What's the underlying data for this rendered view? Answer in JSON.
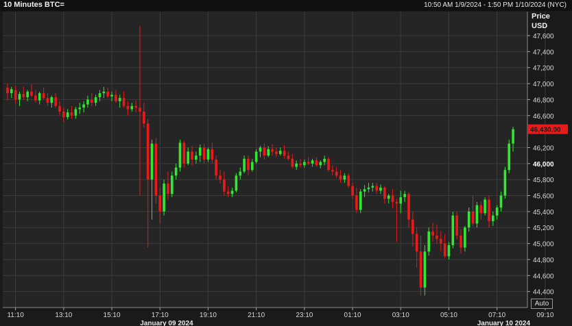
{
  "header": {
    "title": "10 Minutes BTC=",
    "range": "10:50 AM 1/9/2024 - 1:50 PM 1/10/2024 (NYC)"
  },
  "axis_header": {
    "line1": "Price",
    "line2": "USD"
  },
  "auto_button": "Auto",
  "colors": {
    "up": "#33e633",
    "down": "#e81a1a",
    "grid": "#3c3c3c",
    "background": "#252525"
  },
  "chart_data": {
    "type": "candlestick",
    "ylim": [
      44200,
      47900
    ],
    "grid": true,
    "y_ticks": [
      {
        "v": 47600,
        "label": "47,600"
      },
      {
        "v": 47400,
        "label": "47,400"
      },
      {
        "v": 47200,
        "label": "47,200"
      },
      {
        "v": 47000,
        "label": "47,000"
      },
      {
        "v": 46800,
        "label": "46,800"
      },
      {
        "v": 46600,
        "label": "46,600"
      },
      {
        "v": 46200,
        "label": "46,200"
      },
      {
        "v": 46000,
        "label": "46,000",
        "bold": true
      },
      {
        "v": 45800,
        "label": "45,800"
      },
      {
        "v": 45600,
        "label": "45,600"
      },
      {
        "v": 45400,
        "label": "45,400"
      },
      {
        "v": 45200,
        "label": "45,200"
      },
      {
        "v": 45000,
        "label": "45,000"
      },
      {
        "v": 44800,
        "label": "44,800"
      },
      {
        "v": 44600,
        "label": "44,600"
      },
      {
        "v": 44400,
        "label": "44,400"
      }
    ],
    "x_ticks": [
      {
        "i": 2,
        "label": "11:10"
      },
      {
        "i": 14,
        "label": "13:10"
      },
      {
        "i": 26,
        "label": "15:10"
      },
      {
        "i": 38,
        "label": "17:10"
      },
      {
        "i": 50,
        "label": "19:10"
      },
      {
        "i": 62,
        "label": "21:10"
      },
      {
        "i": 74,
        "label": "23:10"
      },
      {
        "i": 86,
        "label": "01:10"
      },
      {
        "i": 98,
        "label": "03:10"
      },
      {
        "i": 110,
        "label": "05:10"
      },
      {
        "i": 122,
        "label": "07:10"
      },
      {
        "i": 134,
        "label": "09:10"
      },
      {
        "i": 146,
        "label": "11:10"
      },
      {
        "i": 158,
        "label": "13:10"
      }
    ],
    "date_labels": [
      {
        "i": 40,
        "label": "January 09 2024"
      },
      {
        "i": 124,
        "label": "January 10 2024"
      }
    ],
    "last_price": {
      "value": 46430,
      "label": "46,430.00"
    },
    "candles": [
      [
        46950,
        47000,
        46800,
        46880
      ],
      [
        46880,
        46960,
        46820,
        46930
      ],
      [
        46920,
        46970,
        46750,
        46800
      ],
      [
        46800,
        46900,
        46720,
        46870
      ],
      [
        46870,
        46960,
        46800,
        46830
      ],
      [
        46830,
        46920,
        46780,
        46900
      ],
      [
        46900,
        46990,
        46830,
        46850
      ],
      [
        46850,
        46920,
        46760,
        46790
      ],
      [
        46790,
        46900,
        46740,
        46880
      ],
      [
        46880,
        46950,
        46800,
        46820
      ],
      [
        46820,
        46880,
        46720,
        46760
      ],
      [
        46760,
        46850,
        46700,
        46830
      ],
      [
        46830,
        46880,
        46700,
        46720
      ],
      [
        46720,
        46780,
        46600,
        46650
      ],
      [
        46650,
        46700,
        46520,
        46580
      ],
      [
        46580,
        46680,
        46550,
        46640
      ],
      [
        46640,
        46720,
        46560,
        46600
      ],
      [
        46600,
        46710,
        46560,
        46680
      ],
      [
        46680,
        46760,
        46620,
        46700
      ],
      [
        46700,
        46780,
        46640,
        46740
      ],
      [
        46740,
        46850,
        46700,
        46800
      ],
      [
        46800,
        46880,
        46720,
        46760
      ],
      [
        46760,
        46860,
        46720,
        46830
      ],
      [
        46830,
        46920,
        46780,
        46880
      ],
      [
        46880,
        46960,
        46820,
        46900
      ],
      [
        46900,
        46950,
        46820,
        46840
      ],
      [
        46840,
        46900,
        46780,
        46860
      ],
      [
        46860,
        46920,
        46760,
        46780
      ],
      [
        46780,
        46860,
        46700,
        46820
      ],
      [
        46820,
        46900,
        46700,
        46720
      ],
      [
        46720,
        46780,
        46600,
        46680
      ],
      [
        46680,
        46760,
        46650,
        46720
      ],
      [
        46720,
        46790,
        46640,
        46700
      ],
      [
        46700,
        47720,
        45600,
        46650
      ],
      [
        46650,
        46760,
        46450,
        46500
      ],
      [
        46500,
        46560,
        44950,
        45800
      ],
      [
        45800,
        46300,
        45300,
        46250
      ],
      [
        46250,
        46320,
        45500,
        45600
      ],
      [
        45600,
        45700,
        45250,
        45400
      ],
      [
        45400,
        45800,
        45350,
        45750
      ],
      [
        45750,
        45900,
        45550,
        45620
      ],
      [
        45620,
        45900,
        45580,
        45850
      ],
      [
        45850,
        46000,
        45800,
        45950
      ],
      [
        45950,
        46300,
        45900,
        46260
      ],
      [
        46260,
        46280,
        45950,
        46000
      ],
      [
        46000,
        46200,
        45980,
        46150
      ],
      [
        46150,
        46220,
        45980,
        46050
      ],
      [
        46050,
        46150,
        46000,
        46100
      ],
      [
        46100,
        46240,
        46020,
        46200
      ],
      [
        46200,
        46250,
        46000,
        46050
      ],
      [
        46050,
        46200,
        46020,
        46180
      ],
      [
        46180,
        46260,
        46000,
        46050
      ],
      [
        46050,
        46100,
        45800,
        45850
      ],
      [
        45850,
        45920,
        45750,
        45800
      ],
      [
        45800,
        45900,
        45600,
        45650
      ],
      [
        45650,
        45720,
        45580,
        45620
      ],
      [
        45620,
        45700,
        45580,
        45660
      ],
      [
        45660,
        45880,
        45640,
        45850
      ],
      [
        45850,
        45950,
        45800,
        45900
      ],
      [
        45900,
        46100,
        45880,
        46060
      ],
      [
        46060,
        46100,
        45850,
        45920
      ],
      [
        45920,
        46060,
        45900,
        46020
      ],
      [
        46020,
        46180,
        46000,
        46150
      ],
      [
        46150,
        46220,
        46080,
        46200
      ],
      [
        46200,
        46250,
        46050,
        46100
      ],
      [
        46100,
        46220,
        46080,
        46180
      ],
      [
        46180,
        46240,
        46100,
        46150
      ],
      [
        46150,
        46200,
        46080,
        46120
      ],
      [
        46120,
        46200,
        46100,
        46160
      ],
      [
        46160,
        46230,
        46060,
        46100
      ],
      [
        46100,
        46150,
        46040,
        46060
      ],
      [
        46060,
        46120,
        45940,
        45960
      ],
      [
        45960,
        46040,
        45920,
        46000
      ],
      [
        46000,
        46060,
        45950,
        45980
      ],
      [
        45980,
        46050,
        45950,
        46020
      ],
      [
        46020,
        46080,
        45980,
        46000
      ],
      [
        46000,
        46060,
        45960,
        46040
      ],
      [
        46040,
        46080,
        45960,
        45980
      ],
      [
        45980,
        46040,
        45940,
        46020
      ],
      [
        46020,
        46100,
        45980,
        46060
      ],
      [
        46060,
        46080,
        45900,
        45920
      ],
      [
        45920,
        45980,
        45850,
        45900
      ],
      [
        45900,
        45960,
        45820,
        45850
      ],
      [
        45850,
        45920,
        45760,
        45800
      ],
      [
        45800,
        45880,
        45760,
        45850
      ],
      [
        45850,
        45880,
        45700,
        45720
      ],
      [
        45720,
        45760,
        45560,
        45600
      ],
      [
        45600,
        45700,
        45380,
        45420
      ],
      [
        45420,
        45680,
        45380,
        45650
      ],
      [
        45650,
        45730,
        45580,
        45680
      ],
      [
        45680,
        45760,
        45640,
        45700
      ],
      [
        45700,
        45760,
        45650,
        45720
      ],
      [
        45720,
        45760,
        45620,
        45660
      ],
      [
        45660,
        45740,
        45620,
        45700
      ],
      [
        45700,
        45720,
        45500,
        45560
      ],
      [
        45560,
        45620,
        45500,
        45600
      ],
      [
        45600,
        45680,
        45440,
        45520
      ],
      [
        45520,
        45560,
        45020,
        45500
      ],
      [
        45500,
        45660,
        45380,
        45580
      ],
      [
        45580,
        45660,
        45520,
        45620
      ],
      [
        45620,
        45640,
        45200,
        45300
      ],
      [
        45300,
        45400,
        44960,
        45120
      ],
      [
        45120,
        45200,
        44700,
        44900
      ],
      [
        44900,
        45100,
        44350,
        44450
      ],
      [
        44450,
        44980,
        44350,
        44900
      ],
      [
        44900,
        45200,
        44850,
        45150
      ],
      [
        45150,
        45260,
        45020,
        45100
      ],
      [
        45100,
        45240,
        45000,
        45060
      ],
      [
        45060,
        45160,
        44900,
        45000
      ],
      [
        45000,
        45120,
        44820,
        44840
      ],
      [
        44840,
        45020,
        44800,
        44980
      ],
      [
        44980,
        45400,
        44940,
        45350
      ],
      [
        45350,
        45400,
        45050,
        45100
      ],
      [
        45100,
        45180,
        44880,
        44950
      ],
      [
        44950,
        45220,
        44900,
        45200
      ],
      [
        45200,
        45450,
        45150,
        45400
      ],
      [
        45400,
        45600,
        45220,
        45250
      ],
      [
        45250,
        45520,
        45200,
        45480
      ],
      [
        45480,
        45520,
        45300,
        45380
      ],
      [
        45380,
        45580,
        45350,
        45550
      ],
      [
        45550,
        45600,
        45200,
        45280
      ],
      [
        45280,
        45400,
        45220,
        45350
      ],
      [
        45350,
        45480,
        45300,
        45450
      ],
      [
        45450,
        45650,
        45400,
        45600
      ],
      [
        45600,
        45960,
        45560,
        45920
      ],
      [
        45920,
        46300,
        45880,
        46250
      ],
      [
        46250,
        46460,
        46150,
        46430
      ]
    ]
  }
}
